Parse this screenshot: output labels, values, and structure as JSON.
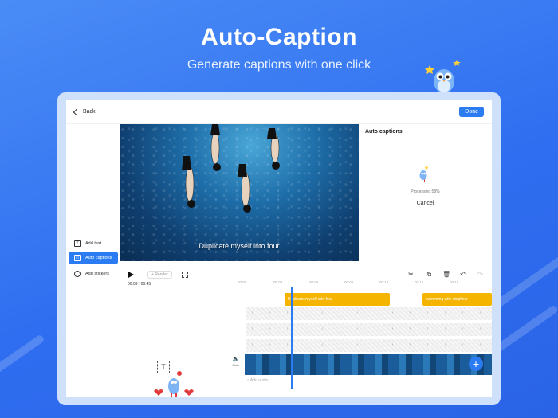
{
  "hero": {
    "title": "Auto-Caption",
    "subtitle": "Generate captions with one click"
  },
  "topbar": {
    "back_label": "Back",
    "done_label": "Done"
  },
  "video": {
    "caption_text": "Duplicate myself into four"
  },
  "panel": {
    "title": "Auto captions",
    "processing_label": "Processing 58%",
    "progress_percent": 58,
    "cancel_label": "Cancel"
  },
  "sidebar": {
    "items": [
      {
        "label": "Add text",
        "icon": "text-icon"
      },
      {
        "label": "Auto captions",
        "icon": "captions-icon"
      },
      {
        "label": "Add stickers",
        "icon": "sticker-icon"
      }
    ]
  },
  "controls": {
    "render_label": "Render",
    "timecode": "00:09 / 00:45"
  },
  "ruler": {
    "ticks": [
      "00:00",
      "00:03",
      "00:06",
      "00:09",
      "00:12",
      "00:15",
      "00:18"
    ]
  },
  "timeline": {
    "caption_clips": [
      "Duplicate myself into four",
      "swimming with dolphins"
    ],
    "mute_label": "Mute",
    "add_audio_label": "Add audio"
  },
  "colors": {
    "accent": "#2b7bf2",
    "caption_clip": "#f4b400",
    "background": "#3a7bf3"
  }
}
